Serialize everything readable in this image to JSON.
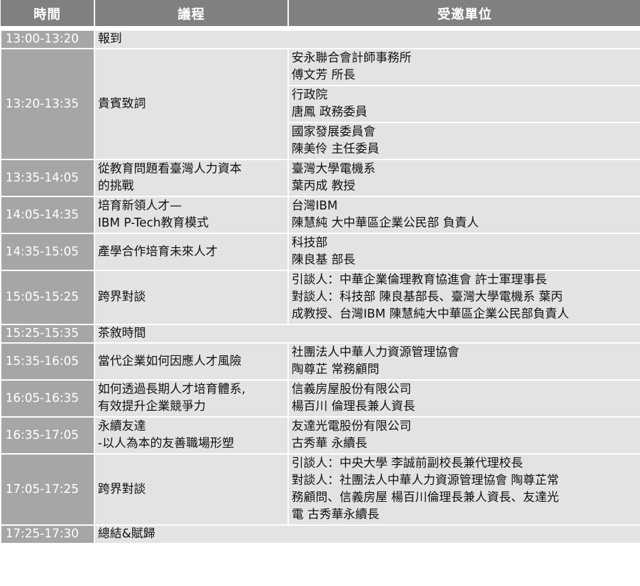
{
  "headers": {
    "time": "時間",
    "agenda": "議程",
    "guest": "受邀單位"
  },
  "rows": [
    {
      "time": "13:00-13:20",
      "agenda": [
        "報到"
      ],
      "guests": []
    },
    {
      "time": "13:20-13:35",
      "agenda": [
        "貴賓致詞"
      ],
      "guests": [
        [
          "安永聯合會計師事務所",
          "傅文芳 所長"
        ],
        [
          "行政院",
          "唐鳳 政務委員"
        ],
        [
          "國家發展委員會",
          "陳美伶 主任委員"
        ]
      ]
    },
    {
      "time": "13:35-14:05",
      "agenda": [
        "從教育問題看臺灣人力資本",
        "的挑戰"
      ],
      "guests": [
        [
          "臺灣大學電機系",
          "葉丙成 教授"
        ]
      ]
    },
    {
      "time": "14:05-14:35",
      "agenda": [
        "培育新領人才—",
        "IBM P-Tech教育模式"
      ],
      "guests": [
        [
          "台灣IBM",
          "陳慧純 大中華區企業公民部 負責人"
        ]
      ]
    },
    {
      "time": "14:35-15:05",
      "agenda": [
        "產學合作培育未來人才"
      ],
      "guests": [
        [
          "科技部",
          "陳良基 部長"
        ]
      ]
    },
    {
      "time": "15:05-15:25",
      "agenda": [
        "跨界對談"
      ],
      "guests": [
        [
          "引談人：中華企業倫理教育協進會 許士軍理事長",
          "對談人：科技部 陳良基部長、臺灣大學電機系 葉丙",
          "成教授、台灣IBM 陳慧純大中華區企業公民部負責人"
        ]
      ]
    },
    {
      "time": "15:25-15:35",
      "agenda": [
        "茶敘時間"
      ],
      "guests": []
    },
    {
      "time": "15:35-16:05",
      "agenda": [
        "當代企業如何因應人才風險"
      ],
      "guests": [
        [
          "社團法人中華人力資源管理協會",
          "陶尊芷 常務顧問"
        ]
      ]
    },
    {
      "time": "16:05-16:35",
      "agenda": [
        "如何透過長期人才培育體系,",
        "有效提升企業競爭力"
      ],
      "guests": [
        [
          "信義房屋股份有限公司",
          "楊百川 倫理長兼人資長"
        ]
      ]
    },
    {
      "time": "16:35-17:05",
      "agenda": [
        "永續友達",
        "-以人為本的友善職場形塑"
      ],
      "guests": [
        [
          "友達光電股份有限公司",
          "古秀華 永續長"
        ]
      ]
    },
    {
      "time": "17:05-17:25",
      "agenda": [
        "跨界對談"
      ],
      "guests": [
        [
          "引談人：中央大學 李誠前副校長兼代理校長",
          "對談人：社團法人中華人力資源管理協會 陶尊芷常",
          "務顧問、信義房屋 楊百川倫理長兼人資長、友達光",
          "電 古秀華永續長"
        ]
      ]
    },
    {
      "time": "17:25-17:30",
      "agenda": [
        "總結&賦歸"
      ],
      "guests": []
    }
  ]
}
